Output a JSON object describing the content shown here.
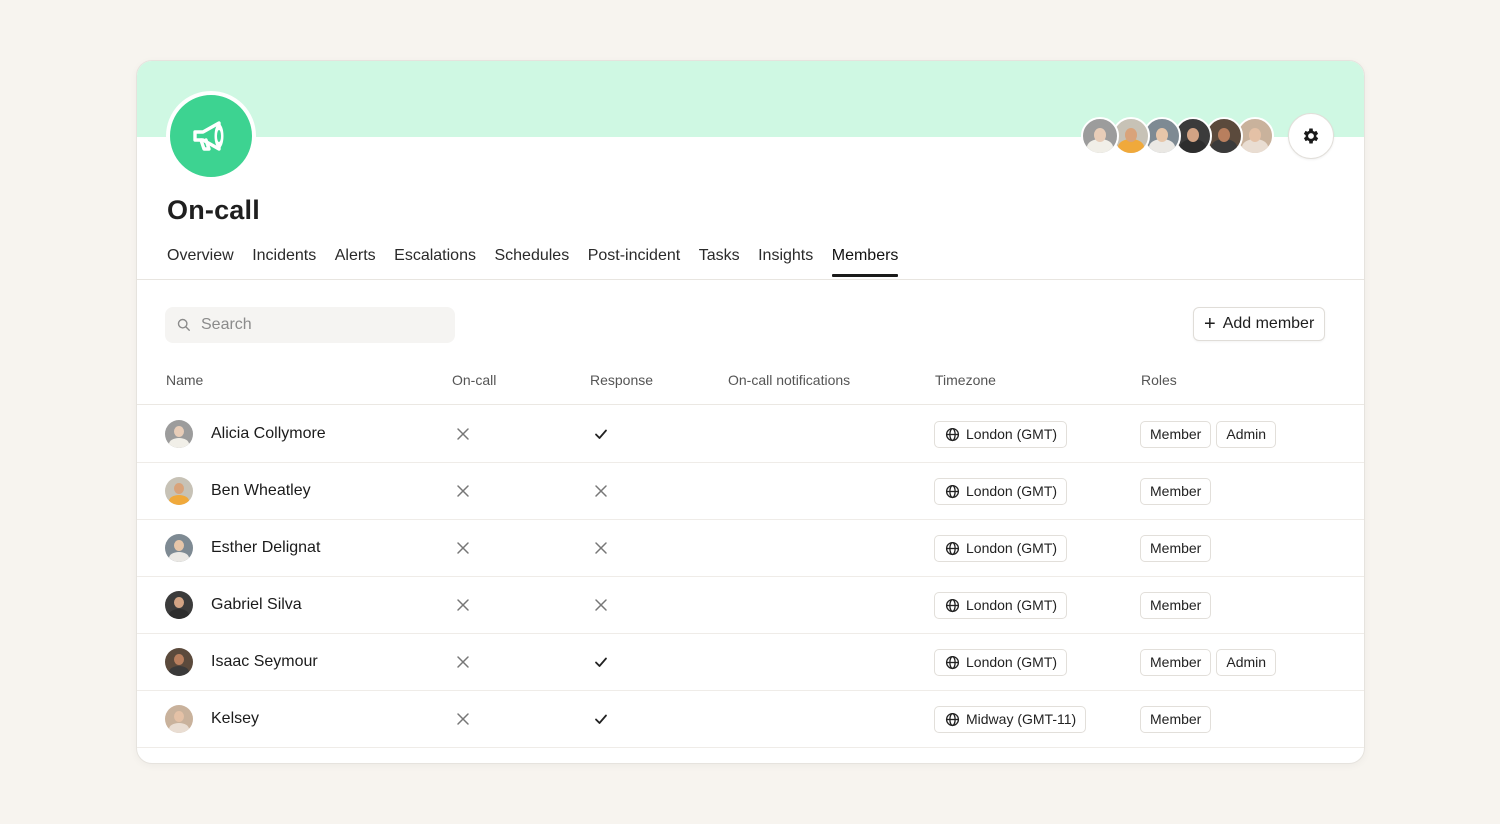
{
  "team": {
    "title": "On-call",
    "icon": "megaphone-icon",
    "accent_color": "#3dd391",
    "banner_color": "#cff8e3"
  },
  "header_avatars": [
    {
      "face": "#e8cdb8",
      "body": "#f1efe8",
      "bg": "#9c9c9c"
    },
    {
      "face": "#d9a37a",
      "body": "#f0a93b",
      "bg": "#c7c2b6"
    },
    {
      "face": "#e7c6a9",
      "body": "#eae8e4",
      "bg": "#7e8a93"
    },
    {
      "face": "#d2a384",
      "body": "#2d2d2d",
      "bg": "#3b3b3b"
    },
    {
      "face": "#b87f5e",
      "body": "#3a3a3a",
      "bg": "#5b4a3c"
    },
    {
      "face": "#e4c1a6",
      "body": "#e9ddd2",
      "bg": "#c9b29c"
    }
  ],
  "tabs": [
    {
      "label": "Overview",
      "active": false
    },
    {
      "label": "Incidents",
      "active": false
    },
    {
      "label": "Alerts",
      "active": false
    },
    {
      "label": "Escalations",
      "active": false
    },
    {
      "label": "Schedules",
      "active": false
    },
    {
      "label": "Post-incident",
      "active": false
    },
    {
      "label": "Tasks",
      "active": false
    },
    {
      "label": "Insights",
      "active": false
    },
    {
      "label": "Members",
      "active": true
    }
  ],
  "search": {
    "placeholder": "Search",
    "value": ""
  },
  "add_member": {
    "label": "Add member"
  },
  "table": {
    "columns": {
      "name": "Name",
      "oncall": "On-call",
      "response": "Response",
      "notifications": "On-call notifications",
      "timezone": "Timezone",
      "roles": "Roles"
    },
    "rows": [
      {
        "name": "Alicia Collymore",
        "oncall": false,
        "response": true,
        "timezone": "London (GMT)",
        "roles": [
          "Member",
          "Admin"
        ],
        "avatar": {
          "face": "#e8cdb8",
          "body": "#f1efe8",
          "bg": "#9c9c9c"
        }
      },
      {
        "name": "Ben Wheatley",
        "oncall": false,
        "response": false,
        "timezone": "London (GMT)",
        "roles": [
          "Member"
        ],
        "avatar": {
          "face": "#d9a37a",
          "body": "#f0a93b",
          "bg": "#c7c2b6"
        }
      },
      {
        "name": "Esther Delignat",
        "oncall": false,
        "response": false,
        "timezone": "London (GMT)",
        "roles": [
          "Member"
        ],
        "avatar": {
          "face": "#e7c6a9",
          "body": "#eae8e4",
          "bg": "#7e8a93"
        }
      },
      {
        "name": "Gabriel Silva",
        "oncall": false,
        "response": false,
        "timezone": "London (GMT)",
        "roles": [
          "Member"
        ],
        "avatar": {
          "face": "#d2a384",
          "body": "#2d2d2d",
          "bg": "#3b3b3b"
        }
      },
      {
        "name": "Isaac Seymour",
        "oncall": false,
        "response": true,
        "timezone": "London (GMT)",
        "roles": [
          "Member",
          "Admin"
        ],
        "avatar": {
          "face": "#b87f5e",
          "body": "#3a3a3a",
          "bg": "#5b4a3c"
        }
      },
      {
        "name": "Kelsey",
        "oncall": false,
        "response": true,
        "timezone": "Midway (GMT-11)",
        "roles": [
          "Member"
        ],
        "avatar": {
          "face": "#e4c1a6",
          "body": "#e9ddd2",
          "bg": "#c9b29c"
        }
      }
    ]
  }
}
